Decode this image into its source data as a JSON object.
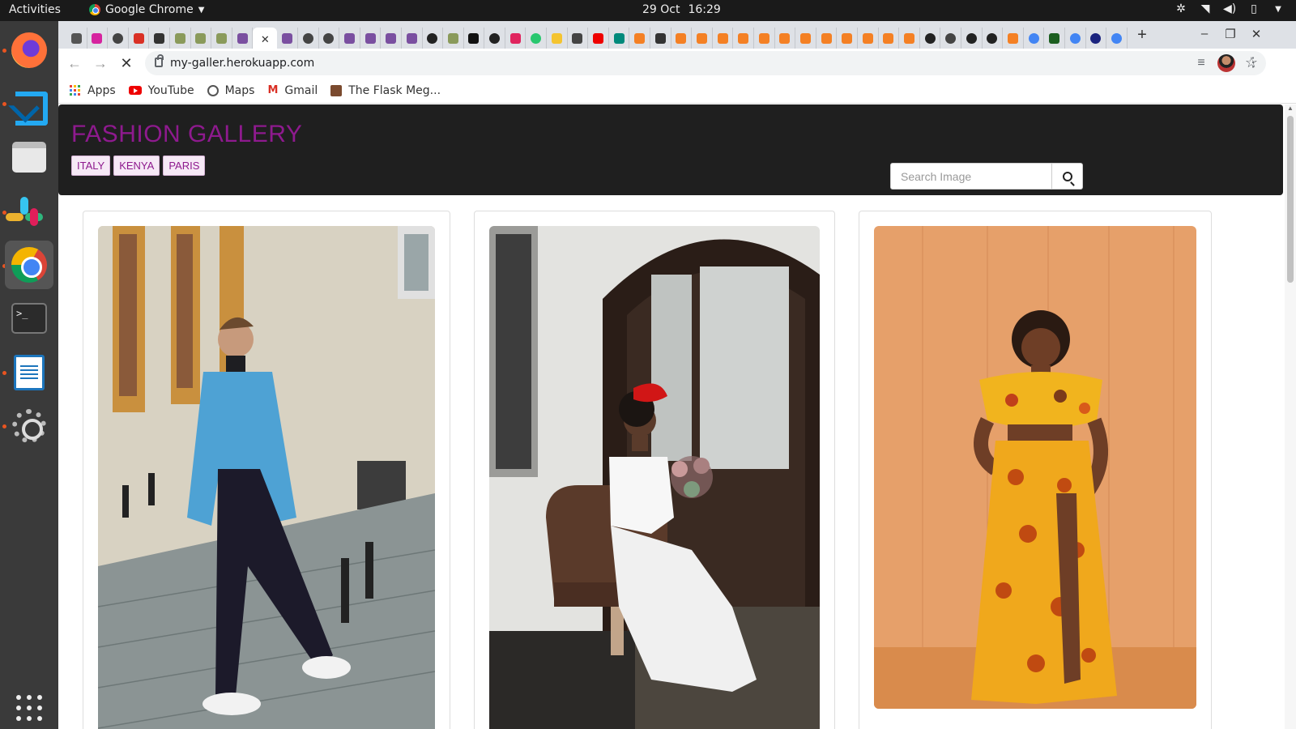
{
  "system_bar": {
    "activities": "Activities",
    "app_name": "Google Chrome",
    "date": "29 Oct",
    "time": "16:29"
  },
  "dock": {
    "apps": [
      "firefox-icon",
      "vscode-icon",
      "files-icon",
      "slack-icon",
      "chrome-icon",
      "terminal-icon",
      "writer-icon",
      "settings-icon",
      "show-applications-icon"
    ]
  },
  "browser": {
    "tabs": [
      {
        "favicon": "audio-icon",
        "color": "#555555"
      },
      {
        "favicon": "instagram-icon",
        "color": "#d6249f"
      },
      {
        "favicon": "globe-icon",
        "color": "#444444"
      },
      {
        "favicon": "gmail-icon",
        "color": "#d93025"
      },
      {
        "favicon": "shield-icon",
        "color": "#333333"
      },
      {
        "favicon": "tree-icon",
        "color": "#8a9a5b"
      },
      {
        "favicon": "tree-icon",
        "color": "#8a9a5b"
      },
      {
        "favicon": "tree-icon",
        "color": "#8a9a5b"
      },
      {
        "favicon": "heroku-icon",
        "color": "#7a4fa0"
      },
      {
        "favicon": "close-icon",
        "color": "#333333",
        "active": true
      },
      {
        "favicon": "heroku-icon",
        "color": "#7a4fa0"
      },
      {
        "favicon": "globe-icon",
        "color": "#444444"
      },
      {
        "favicon": "globe-icon",
        "color": "#444444"
      },
      {
        "favicon": "heroku-icon",
        "color": "#7a4fa0"
      },
      {
        "favicon": "heroku-icon",
        "color": "#7a4fa0"
      },
      {
        "favicon": "heroku-icon",
        "color": "#7a4fa0"
      },
      {
        "favicon": "heroku-icon",
        "color": "#7a4fa0"
      },
      {
        "favicon": "github-icon",
        "color": "#222222"
      },
      {
        "favicon": "tree-icon",
        "color": "#8a9a5b"
      },
      {
        "favicon": "w-icon",
        "color": "#111111"
      },
      {
        "favicon": "github-icon",
        "color": "#222222"
      },
      {
        "favicon": "red-icon",
        "color": "#e0245e"
      },
      {
        "favicon": "green-icon",
        "color": "#28c76f"
      },
      {
        "favicon": "ty-icon",
        "color": "#f4c430"
      },
      {
        "favicon": "u-icon",
        "color": "#444444"
      },
      {
        "favicon": "youtube-icon",
        "color": "#ee0000"
      },
      {
        "favicon": "meet-icon",
        "color": "#00897b"
      },
      {
        "favicon": "stack-icon",
        "color": "#f48024"
      },
      {
        "favicon": "book-icon",
        "color": "#333333"
      },
      {
        "favicon": "stack-icon",
        "color": "#f48024"
      },
      {
        "favicon": "stack-icon",
        "color": "#f48024"
      },
      {
        "favicon": "stack-icon",
        "color": "#f48024"
      },
      {
        "favicon": "stack-icon",
        "color": "#f48024"
      },
      {
        "favicon": "stack-icon",
        "color": "#f48024"
      },
      {
        "favicon": "stack-icon",
        "color": "#f48024"
      },
      {
        "favicon": "stack-icon",
        "color": "#f48024"
      },
      {
        "favicon": "stack-icon",
        "color": "#f48024"
      },
      {
        "favicon": "stack-icon",
        "color": "#f48024"
      },
      {
        "favicon": "stack-icon",
        "color": "#f48024"
      },
      {
        "favicon": "stack-icon",
        "color": "#f48024"
      },
      {
        "favicon": "stack-icon",
        "color": "#f48024"
      },
      {
        "favicon": "github-icon",
        "color": "#222222"
      },
      {
        "favicon": "globe-icon",
        "color": "#444444"
      },
      {
        "favicon": "github-icon",
        "color": "#222222"
      },
      {
        "favicon": "github-icon",
        "color": "#222222"
      },
      {
        "favicon": "stack-icon",
        "color": "#f48024"
      },
      {
        "favicon": "google-icon",
        "color": "#4285f4"
      },
      {
        "favicon": "gear-icon",
        "color": "#1b5e20"
      },
      {
        "favicon": "google-icon",
        "color": "#4285f4"
      },
      {
        "favicon": "circle-icon",
        "color": "#1a237e"
      },
      {
        "favicon": "google-icon",
        "color": "#4285f4"
      }
    ],
    "url": "my-galler.herokuapp.com",
    "bookmarks": [
      {
        "label": "Apps",
        "icon": "apps-grid-icon"
      },
      {
        "label": "YouTube",
        "icon": "youtube-icon"
      },
      {
        "label": "Maps",
        "icon": "globe-icon"
      },
      {
        "label": "Gmail",
        "icon": "gmail-icon"
      },
      {
        "label": "The Flask Meg...",
        "icon": "flask-icon"
      }
    ]
  },
  "site": {
    "brand": "FASHION GALLERY",
    "brand_color": "#8e1a8e",
    "locations": [
      "ITALY",
      "KENYA",
      "PARIS"
    ],
    "search_placeholder": "Search Image",
    "gallery": [
      {
        "subject": "man in denim jacket on cobblestone street"
      },
      {
        "subject": "woman in white dress with red fascinator seated on chair"
      },
      {
        "subject": "woman in orange african print dress against wooden wall"
      }
    ]
  }
}
